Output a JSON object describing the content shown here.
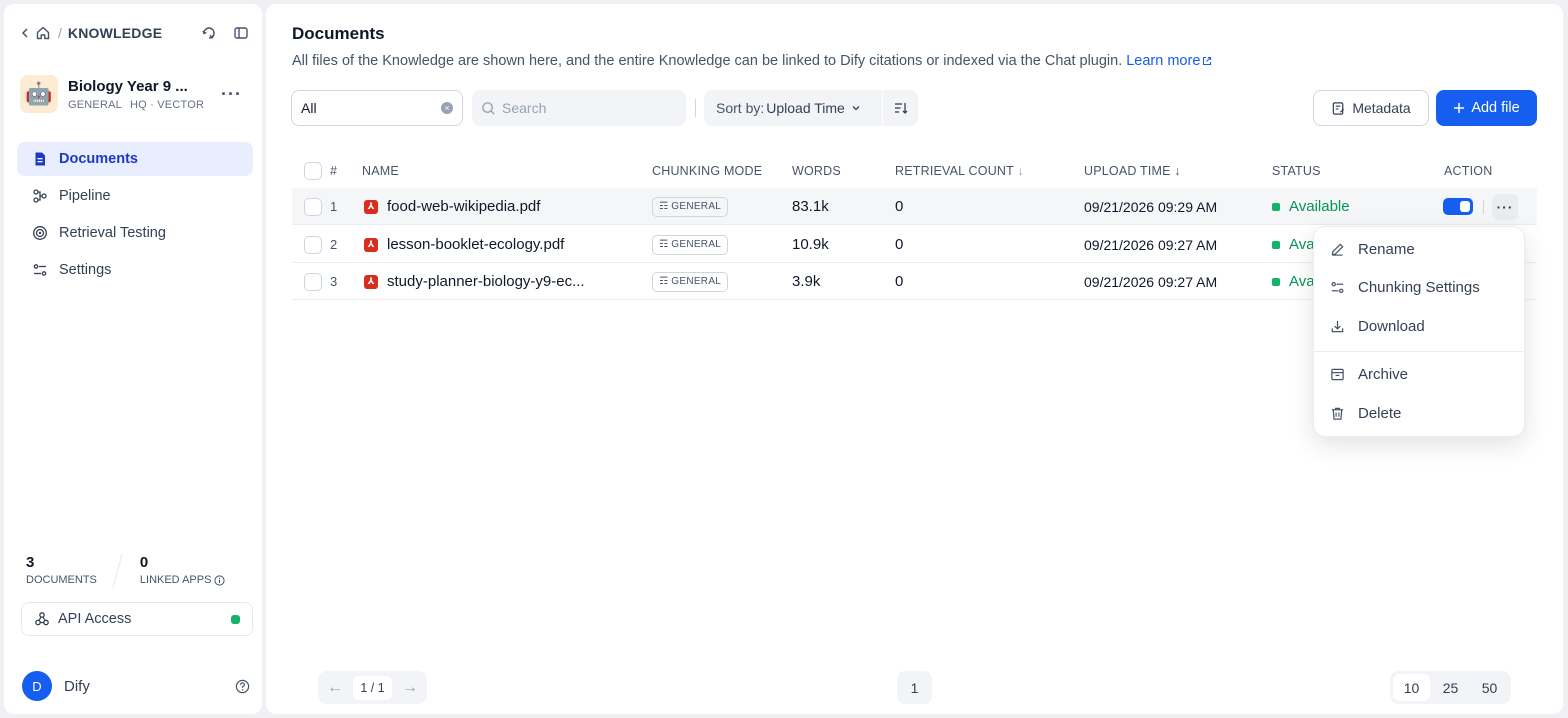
{
  "sidebar": {
    "breadcrumb": "KNOWLEDGE",
    "kb_name": "Biology Year 9 ...",
    "kb_tag1": "GENERAL",
    "kb_tag2": "HQ · VECTOR",
    "kb_avatar": "🤖",
    "nav": [
      {
        "label": "Documents",
        "icon": "document-icon",
        "active": true
      },
      {
        "label": "Pipeline",
        "icon": "pipeline-icon"
      },
      {
        "label": "Retrieval Testing",
        "icon": "target-icon"
      },
      {
        "label": "Settings",
        "icon": "sliders-icon"
      }
    ],
    "stats": {
      "documents_count": "3",
      "documents_label": "DOCUMENTS",
      "apps_count": "0",
      "apps_label": "LINKED APPS"
    },
    "api_access": "API Access",
    "user_initial": "D",
    "user_name": "Dify"
  },
  "main": {
    "title": "Documents",
    "description": "All files of the Knowledge are shown here, and the entire Knowledge can be linked to Dify citations or indexed via the Chat plugin.",
    "learn_more": "Learn more",
    "filter_value": "All",
    "search_placeholder": "Search",
    "sort_prefix": "Sort by:",
    "sort_value": "Upload Time",
    "metadata_btn": "Metadata",
    "add_file_btn": "Add file"
  },
  "table": {
    "headers": {
      "num": "#",
      "name": "NAME",
      "chunking": "CHUNKING MODE",
      "words": "WORDS",
      "retrieval": "RETRIEVAL COUNT",
      "upload": "UPLOAD TIME",
      "status": "STATUS",
      "action": "ACTION"
    },
    "rows": [
      {
        "index": "1",
        "name": "food-web-wikipedia.pdf",
        "mode": "GENERAL",
        "words": "83.1k",
        "retrieval": "0",
        "upload": "09/21/2026 09:29 AM",
        "status": "Available"
      },
      {
        "index": "2",
        "name": "lesson-booklet-ecology.pdf",
        "mode": "GENERAL",
        "words": "10.9k",
        "retrieval": "0",
        "upload": "09/21/2026 09:27 AM",
        "status": "Ava"
      },
      {
        "index": "3",
        "name": "study-planner-biology-y9-ec...",
        "mode": "GENERAL",
        "words": "3.9k",
        "retrieval": "0",
        "upload": "09/21/2026 09:27 AM",
        "status": "Ava"
      }
    ]
  },
  "menu": {
    "rename": "Rename",
    "chunking_settings": "Chunking Settings",
    "download": "Download",
    "archive": "Archive",
    "delete": "Delete"
  },
  "pagination": {
    "current": "1 / 1",
    "page": "1",
    "sizes": [
      "10",
      "25",
      "50"
    ],
    "selected_size": "10"
  },
  "colors": {
    "accent": "#155eef",
    "status_available": "#17b26a",
    "pdf": "#d92d20"
  }
}
